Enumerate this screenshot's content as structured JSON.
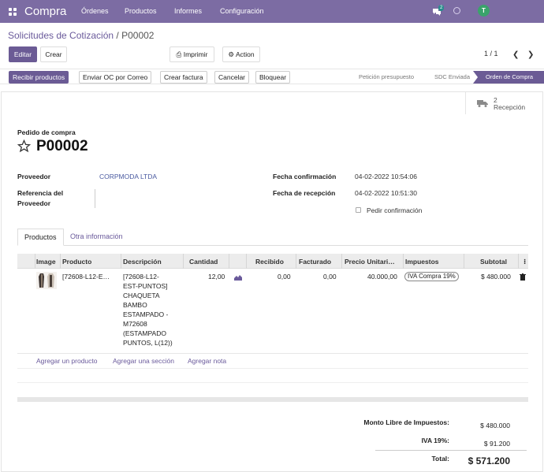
{
  "topbar": {
    "app": "Compra",
    "menu": [
      "Órdenes",
      "Productos",
      "Informes",
      "Configuración"
    ],
    "chat_count": "2",
    "user_initial": "T"
  },
  "breadcrumb": {
    "parent": "Solicitudes de Cotización",
    "separator": " / ",
    "current": "P00002"
  },
  "toolbar": {
    "edit": "Editar",
    "create": "Crear",
    "print": "Imprimir",
    "action": "Action",
    "pager": "1 / 1"
  },
  "status": {
    "buttons": [
      "Recibir productos",
      "Enviar OC por Correo",
      "Crear factura",
      "Cancelar",
      "Bloquear"
    ],
    "stages": [
      "Petición presupuesto",
      "SDC Enviada",
      "Orden de Compra"
    ]
  },
  "smart": {
    "count": "2",
    "label": "Recepción"
  },
  "form": {
    "type_label": "Pedido de compra",
    "name": "P00002",
    "vendor_label": "Proveedor",
    "vendor": "CORPMODA LTDA",
    "ref_label_1": "Referencia del",
    "ref_label_2": "Proveedor",
    "confirm_label": "Fecha confirmación",
    "confirm": "04-02-2022 10:54:06",
    "receipt_label": "Fecha de recepción",
    "receipt": "04-02-2022 10:51:30",
    "ask_confirm": "Pedir confirmación"
  },
  "tabs": [
    "Productos",
    "Otra información"
  ],
  "table": {
    "headers": [
      "Image",
      "Producto",
      "Descripción",
      "Cantidad",
      "Recibido",
      "Facturado",
      "Precio Unitari…",
      "Impuestos",
      "Subtotal"
    ],
    "row": {
      "product": "[72608-L12-E…",
      "desc": [
        "[72608-L12-",
        "EST-PUNTOS]",
        "CHAQUETA",
        "BAMBO",
        "ESTAMPADO -",
        "M72608",
        "(ESTAMPADO",
        "PUNTOS, L(12))"
      ],
      "qty": "12,00",
      "received": "0,00",
      "invoiced": "0,00",
      "price": "40.000,00",
      "tax": "IVA Compra 19%",
      "subtotal": "$ 480.000"
    }
  },
  "add_links": [
    "Agregar un producto",
    "Agregar una sección",
    "Agregar nota"
  ],
  "totals": {
    "untaxed_label": "Monto Libre de Impuestos:",
    "untaxed": "$ 480.000",
    "tax_label": "IVA 19%:",
    "tax": "$ 91.200",
    "total_label": "Total:",
    "total": "$ 571.200"
  },
  "colors": {
    "brand": "#7c6ca3",
    "primary": "#6b5b95"
  }
}
